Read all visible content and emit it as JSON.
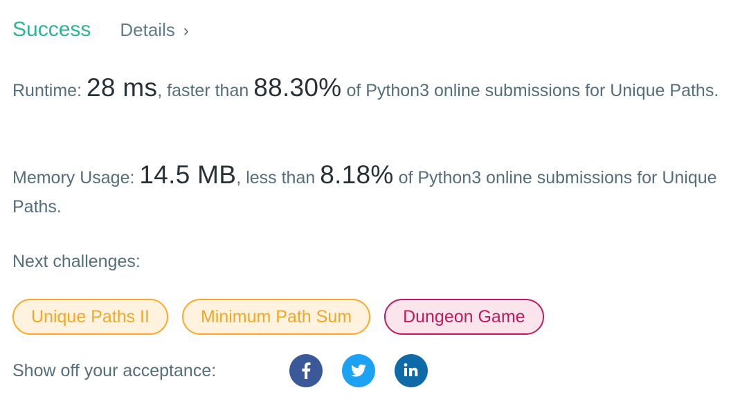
{
  "header": {
    "status": "Success",
    "details_label": "Details",
    "details_chevron": "›"
  },
  "runtime": {
    "label": "Runtime: ",
    "value": "28 ms",
    "mid": ", faster than ",
    "percent": "88.30%",
    "suffix": " of Python3 online submissions for Unique Paths."
  },
  "memory": {
    "label": "Memory Usage: ",
    "value": "14.5 MB",
    "mid": ", less than ",
    "percent": "8.18%",
    "suffix": " of Python3 online submissions for Unique Paths."
  },
  "next": {
    "label": "Next challenges:",
    "items": [
      {
        "label": "Unique Paths II",
        "difficulty": "medium"
      },
      {
        "label": "Minimum Path Sum",
        "difficulty": "medium"
      },
      {
        "label": "Dungeon Game",
        "difficulty": "hard"
      }
    ]
  },
  "share": {
    "label": "Show off your acceptance:",
    "icons": [
      "facebook-icon",
      "twitter-icon",
      "linkedin-icon"
    ]
  },
  "colors": {
    "success": "#2db395",
    "medium_border": "#ffa726",
    "medium_bg": "#fff3e0",
    "hard_border": "#c2185b",
    "hard_bg": "#fce4ec",
    "facebook": "#3b5998",
    "twitter": "#1da1f2",
    "linkedin": "#0e6ba8"
  }
}
